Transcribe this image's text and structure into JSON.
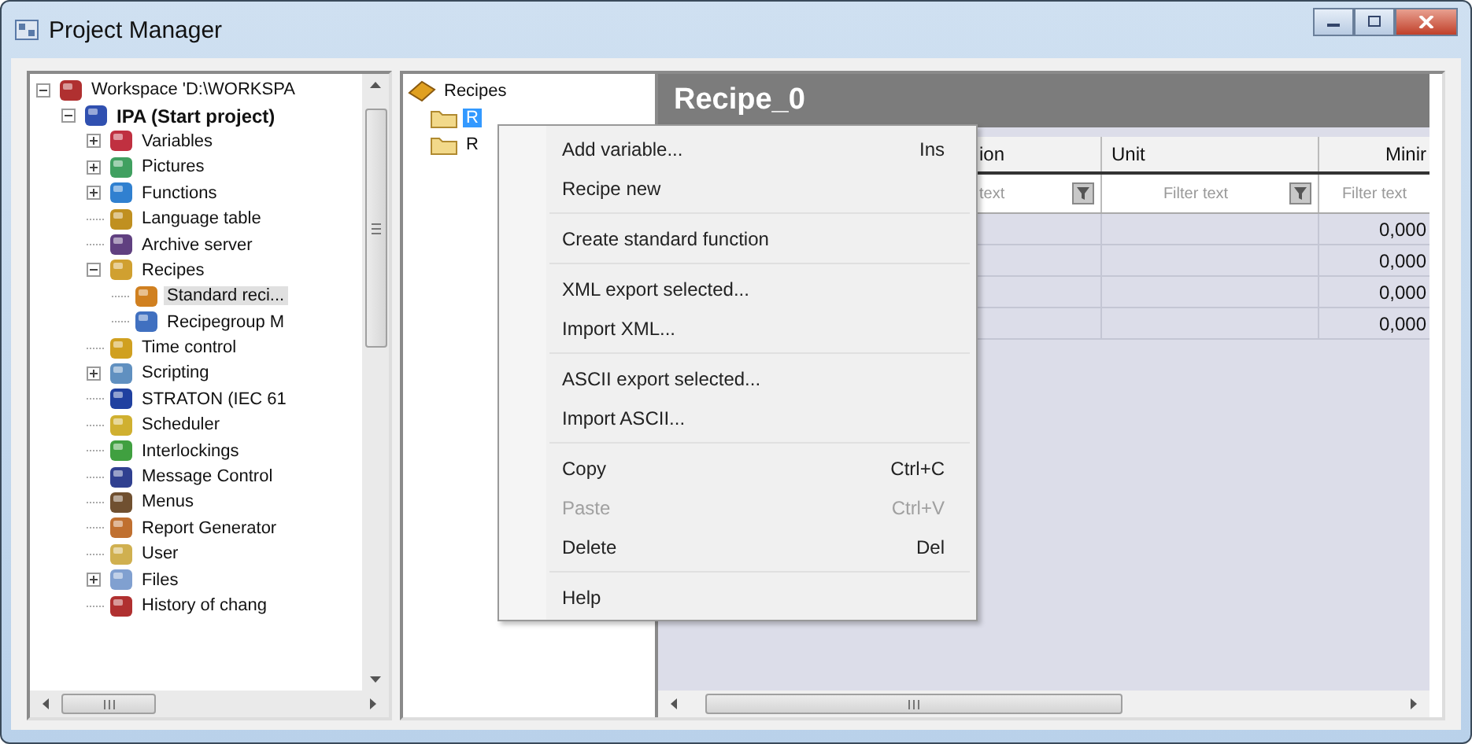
{
  "window": {
    "title": "Project Manager"
  },
  "project_tree": [
    {
      "label": "Workspace 'D:\\WORKSPA",
      "expanded": true,
      "selected": false,
      "children": [
        {
          "label": "IPA (Start project)",
          "bold": true,
          "expanded": true,
          "selected": false,
          "children": [
            {
              "label": "Variables",
              "expanded": false,
              "selected": false
            },
            {
              "label": "Pictures",
              "expanded": false,
              "selected": false
            },
            {
              "label": "Functions",
              "expanded": false,
              "selected": false
            },
            {
              "label": "Language table",
              "selected": false
            },
            {
              "label": "Archive server",
              "selected": false
            },
            {
              "label": "Recipes",
              "expanded": true,
              "selected": false,
              "children": [
                {
                  "label": "Standard reci...",
                  "selected": true
                },
                {
                  "label": "Recipegroup M",
                  "selected": false
                }
              ]
            },
            {
              "label": "Time control",
              "selected": false
            },
            {
              "label": "Scripting",
              "expanded": false,
              "selected": false
            },
            {
              "label": "STRATON (IEC 61",
              "selected": false
            },
            {
              "label": "Scheduler",
              "selected": false
            },
            {
              "label": "Interlockings",
              "selected": false
            },
            {
              "label": "Message Control",
              "selected": false
            },
            {
              "label": "Menus",
              "selected": false
            },
            {
              "label": "Report Generator",
              "selected": false
            },
            {
              "label": "User",
              "selected": false
            },
            {
              "label": "Files",
              "expanded": false,
              "selected": false
            },
            {
              "label": "History of chang",
              "selected": false
            }
          ]
        }
      ]
    }
  ],
  "recipe_tree": {
    "label": "Recipes",
    "children": [
      {
        "label": "R",
        "selected": true
      },
      {
        "label": "R",
        "selected": false
      }
    ]
  },
  "recipe_panel": {
    "title": "Recipe_0",
    "columns": [
      {
        "label": "ion",
        "filter": "text"
      },
      {
        "label": "Unit",
        "filter": "Filter text"
      },
      {
        "label": "Minir",
        "filter": "Filter text"
      }
    ],
    "rows": [
      [
        "",
        "",
        "0,000"
      ],
      [
        "",
        "",
        "0,000"
      ],
      [
        "",
        "",
        "0,000"
      ],
      [
        "",
        "",
        "0,000"
      ]
    ]
  },
  "context_menu": [
    [
      {
        "label": "Add variable...",
        "shortcut": "Ins",
        "disabled": false
      },
      {
        "label": "Recipe new",
        "disabled": false
      }
    ],
    [
      {
        "label": "Create standard function",
        "disabled": false
      }
    ],
    [
      {
        "label": "XML export selected...",
        "disabled": false
      },
      {
        "label": "Import XML...",
        "disabled": false
      }
    ],
    [
      {
        "label": "ASCII export selected...",
        "disabled": false
      },
      {
        "label": "Import ASCII...",
        "disabled": false
      }
    ],
    [
      {
        "label": "Copy",
        "shortcut": "Ctrl+C",
        "disabled": false
      },
      {
        "label": "Paste",
        "shortcut": "Ctrl+V",
        "disabled": true
      },
      {
        "label": "Delete",
        "shortcut": "Del",
        "disabled": false
      }
    ],
    [
      {
        "label": "Help",
        "disabled": false
      }
    ]
  ]
}
